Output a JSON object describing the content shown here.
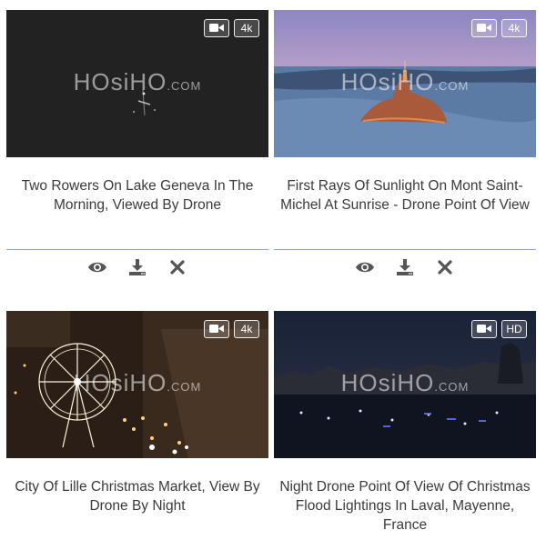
{
  "cards": [
    {
      "title": "Two Rowers On Lake Geneva In The Morning, Viewed By Drone",
      "watermark": "HOsiHO",
      "watermark_suffix": ".COM",
      "badges": [
        "video-camera-icon",
        "4k"
      ],
      "badge_text": "4k",
      "actions": [
        "eye-icon",
        "download-icon",
        "close-icon"
      ],
      "scene": "dark-lake"
    },
    {
      "title": "First Rays Of Sunlight On Mont Saint-Michel At Sunrise - Drone Point Of View",
      "watermark": "HOsiHO",
      "watermark_suffix": ".COM",
      "badges": [
        "video-camera-icon",
        "4k"
      ],
      "badge_text": "4k",
      "actions": [
        "eye-icon",
        "download-icon",
        "close-icon"
      ],
      "scene": "mont-saint-michel"
    },
    {
      "title": "City Of Lille Christmas Market, View By Drone By Night",
      "watermark": "HOsiHO",
      "watermark_suffix": ".COM",
      "badges": [
        "video-camera-icon",
        "4k"
      ],
      "badge_text": "4k",
      "scene": "lille-market"
    },
    {
      "title": "Night Drone Point Of View Of Christmas Flood Lightings In Laval, Mayenne, France",
      "watermark": "HOsiHO",
      "watermark_suffix": ".COM",
      "badges": [
        "video-camera-icon",
        "HD"
      ],
      "badge_text": "HD",
      "scene": "laval-night"
    }
  ],
  "colors": {
    "divider": "#8fa9cf",
    "icon": "#555555",
    "title_text": "#3a3a3a"
  }
}
